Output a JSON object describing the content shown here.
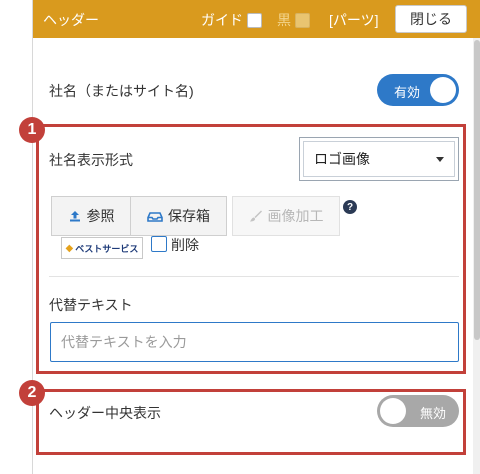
{
  "header": {
    "title": "ヘッダー",
    "guide_label": "ガイド",
    "black_label": "黒",
    "parts_label": "[パーツ]",
    "close_label": "閉じる"
  },
  "company_name": {
    "label": "社名（またはサイト名)",
    "toggle_label": "有効",
    "toggle_state": "on"
  },
  "badges": [
    "1",
    "2"
  ],
  "display_format": {
    "label": "社名表示形式",
    "selected": "ロゴ画像"
  },
  "buttons": {
    "reference": "参照",
    "storage": "保存箱",
    "image_edit": "画像加工",
    "help": "?"
  },
  "logo": {
    "text": "ベストサービス",
    "mark": "◆"
  },
  "delete_label": "削除",
  "alt_text": {
    "label": "代替テキスト",
    "placeholder": "代替テキストを入力",
    "value": ""
  },
  "header_center": {
    "label": "ヘッダー中央表示",
    "toggle_label": "無効",
    "toggle_state": "off"
  },
  "colors": {
    "header_bg": "#d99a1e",
    "accent": "#2e79c8",
    "highlight": "#c2403a"
  }
}
